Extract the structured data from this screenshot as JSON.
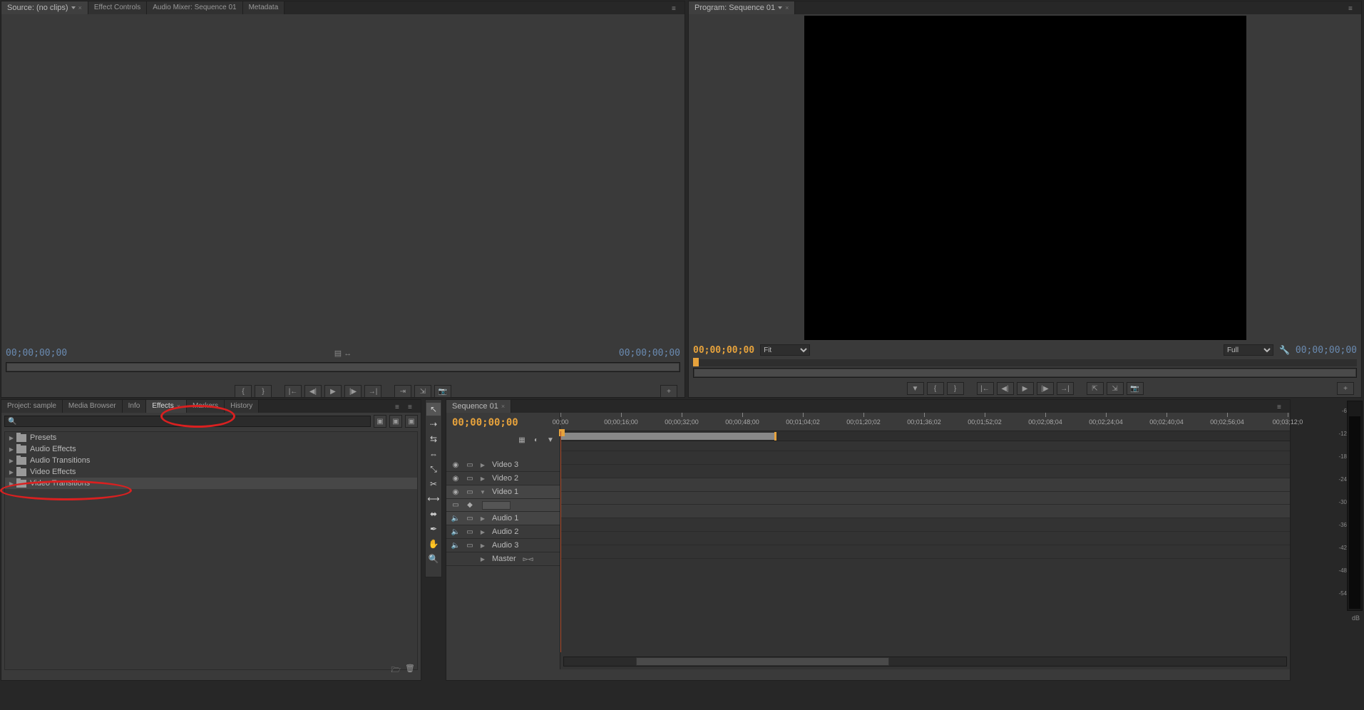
{
  "source": {
    "tabs": [
      {
        "label": "Source: (no clips)",
        "active": true,
        "dd": true
      },
      {
        "label": "Effect Controls"
      },
      {
        "label": "Audio Mixer: Sequence 01"
      },
      {
        "label": "Metadata"
      }
    ],
    "time_left": "00;00;00;00",
    "time_right": "00;00;00;00"
  },
  "program": {
    "tab": "Program: Sequence 01",
    "time_left": "00;00;00;00",
    "fit": "Fit",
    "full": "Full",
    "time_right": "00;00;00;00"
  },
  "project": {
    "tabs": [
      {
        "label": "Project: sample"
      },
      {
        "label": "Media Browser"
      },
      {
        "label": "Info"
      },
      {
        "label": "Effects",
        "active": true,
        "close": true
      },
      {
        "label": "Markers"
      },
      {
        "label": "History"
      }
    ],
    "search_placeholder": "",
    "tree": [
      {
        "label": "Presets"
      },
      {
        "label": "Audio Effects"
      },
      {
        "label": "Audio Transitions"
      },
      {
        "label": "Video Effects"
      },
      {
        "label": "Video Transitions",
        "sel": true
      }
    ]
  },
  "timeline": {
    "tab": "Sequence 01",
    "playhead": "00;00;00;00",
    "ruler": [
      "00;00",
      "00;00;16;00",
      "00;00;32;00",
      "00;00;48;00",
      "00;01;04;02",
      "00;01;20;02",
      "00;01;36;02",
      "00;01;52;02",
      "00;02;08;04",
      "00;02;24;04",
      "00;02;40;04",
      "00;02;56;04",
      "00;03;12;0"
    ],
    "tracks": [
      {
        "label": "Video 3",
        "type": "v"
      },
      {
        "label": "Video 2",
        "type": "v"
      },
      {
        "label": "Video 1",
        "type": "v",
        "expanded": true,
        "sel": true
      },
      {
        "label": "Audio 1",
        "type": "a",
        "sel": true
      },
      {
        "label": "Audio 2",
        "type": "a"
      },
      {
        "label": "Audio 3",
        "type": "a"
      },
      {
        "label": "Master",
        "type": "m"
      }
    ]
  },
  "meter": {
    "ticks": [
      "-6",
      "-12",
      "-18",
      "-24",
      "-30",
      "-36",
      "-42",
      "-48",
      "-54"
    ],
    "label": "dB"
  },
  "icons": {
    "eye": "◉",
    "speaker": "🔈",
    "lock": "🔒",
    "cog": "⚙"
  }
}
